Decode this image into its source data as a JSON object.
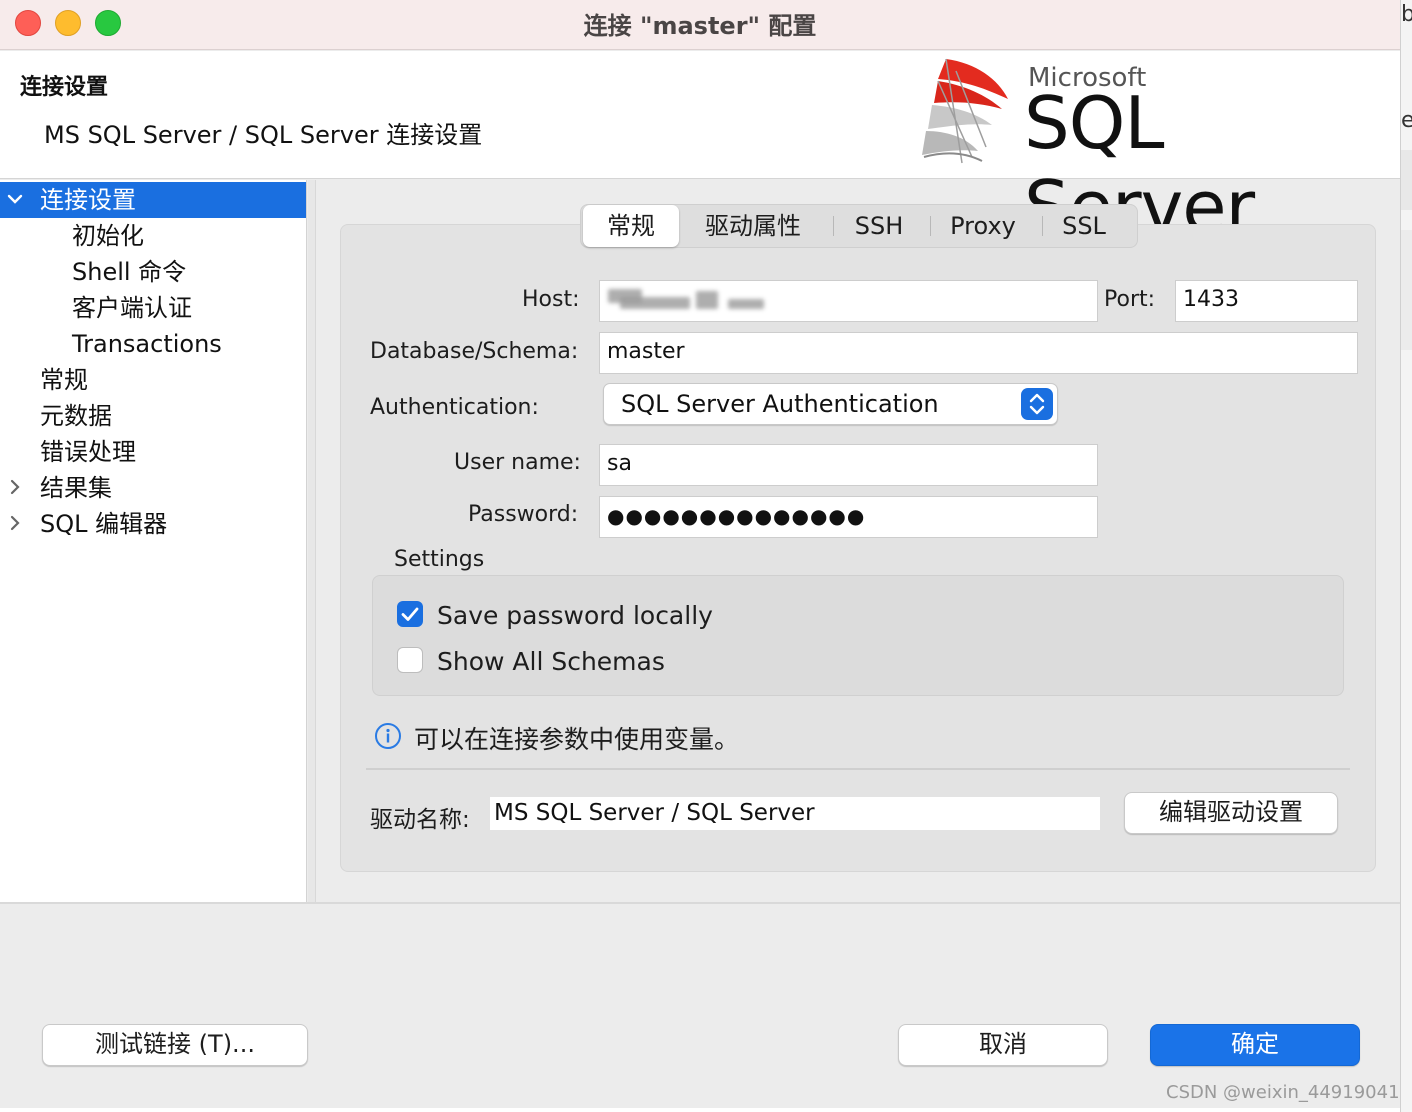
{
  "window": {
    "title": "连接 \"master\" 配置"
  },
  "header": {
    "title": "连接设置",
    "subtitle": "MS SQL Server / SQL Server 连接设置",
    "logo_top": "Microsoft",
    "logo_main": "SQL Server"
  },
  "sidebar": {
    "items": [
      {
        "label": "连接设置",
        "chevron": "v"
      },
      {
        "label": "初始化"
      },
      {
        "label": "Shell 命令"
      },
      {
        "label": "客户端认证"
      },
      {
        "label": "Transactions"
      },
      {
        "label": "常规"
      },
      {
        "label": "元数据"
      },
      {
        "label": "错误处理"
      },
      {
        "label": "结果集",
        "chevron": ">"
      },
      {
        "label": "SQL 编辑器",
        "chevron": ">"
      }
    ]
  },
  "tabs": [
    "常规",
    "驱动属性",
    "SSH",
    "Proxy",
    "SSL"
  ],
  "form": {
    "host_label": "Host:",
    "port_label": "Port:",
    "port_value": "1433",
    "database_label": "Database/Schema:",
    "database_value": "master",
    "auth_label": "Authentication:",
    "auth_value": "SQL Server Authentication",
    "username_label": "User name:",
    "username_value": "sa",
    "password_label": "Password:",
    "password_value": "●●●●●●●●●●●●●●"
  },
  "settings": {
    "label": "Settings",
    "save_password": "Save password locally",
    "show_schemas": "Show All Schemas"
  },
  "info_text": "可以在连接参数中使用变量。",
  "driver": {
    "label": "驱动名称:",
    "value": "MS SQL Server / SQL Server",
    "edit_button": "编辑驱动设置"
  },
  "footer": {
    "test_button": "测试链接 (T)...",
    "cancel_button": "取消",
    "ok_button": "确定"
  },
  "background_window": {
    "fragment_top": "b",
    "fragment_mid": "e"
  },
  "watermark": "CSDN @weixin_44919041",
  "colors": {
    "accent": "#1a6fe0",
    "titlebar": "#f7ebeb",
    "panel": "#e3e3e3",
    "logo_red": "#e32b1f"
  }
}
